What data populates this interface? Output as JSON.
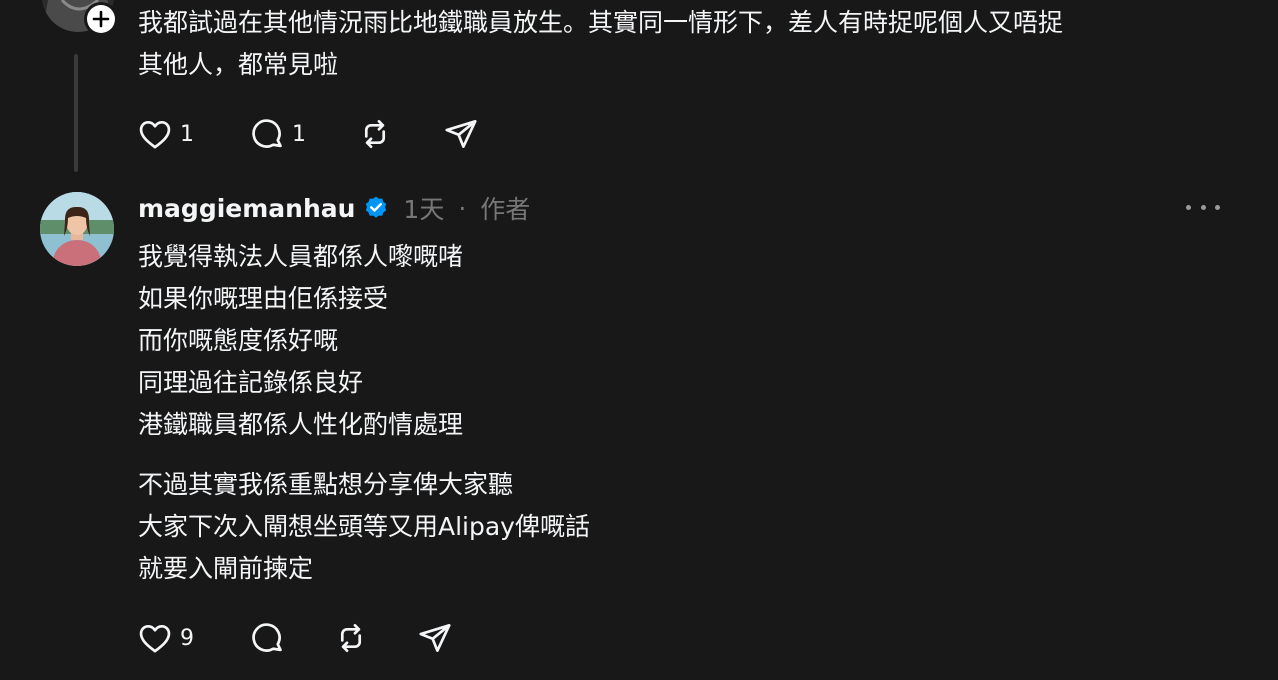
{
  "post1": {
    "text": "我都試過在其他情況雨比地鐵職員放生。其實同一情形下，差人有時捉呢個人又唔捉\n其他人，都常見啦",
    "likes": "1",
    "replies": "1"
  },
  "post2": {
    "username": "maggiemanhau",
    "time": "1天",
    "separator": "·",
    "role": "作者",
    "paragraph1": "我覺得執法人員都係人嚟嘅啫\n如果你嘅理由佢係接受\n而你嘅態度係好嘅\n同理過往記錄係良好\n港鐵職員都係人性化酌情處理",
    "paragraph2": "不過其實我係重點想分享俾大家聽\n大家下次入閘想坐頭等又用Alipay俾嘅話\n就要入閘前揀定",
    "likes": "9"
  },
  "icons": {
    "like": "heart-icon",
    "reply": "comment-icon",
    "repost": "repost-icon",
    "share": "send-icon",
    "verified": "verified-badge-icon",
    "more": "more-icon",
    "follow": "plus-icon"
  },
  "colors": {
    "background": "#181818",
    "text": "#f3f5f7",
    "muted": "#777777",
    "verified": "#0095f6"
  }
}
